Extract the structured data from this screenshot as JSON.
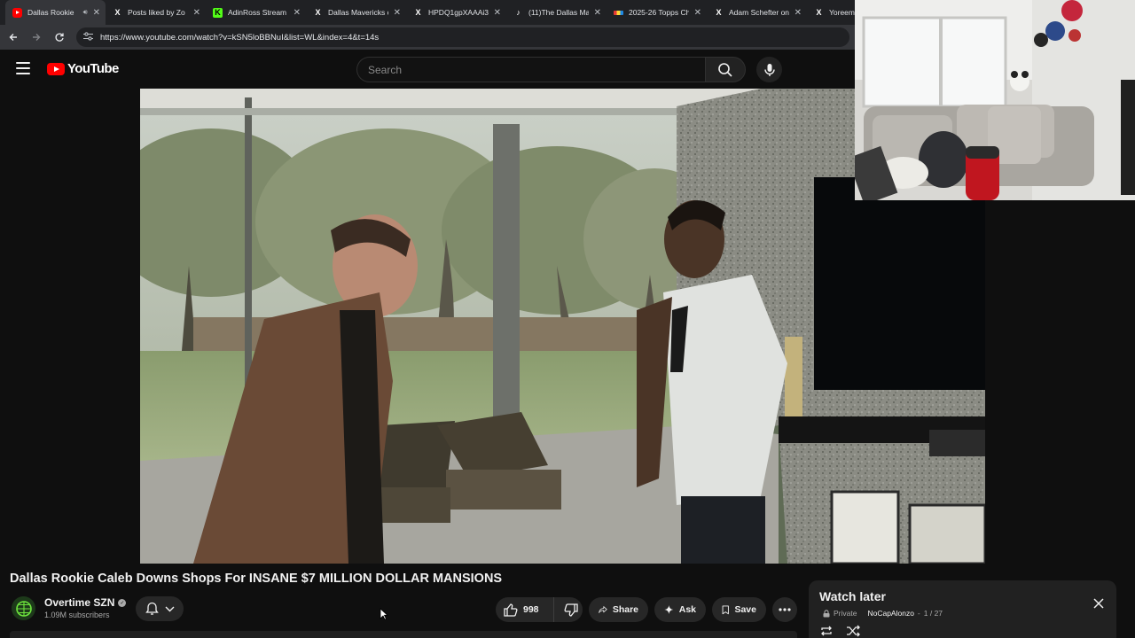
{
  "browser": {
    "tabs": [
      {
        "title": "Dallas Rookie",
        "favicon": "youtube-icon",
        "active": true,
        "audio": true
      },
      {
        "title": "Posts liked by Zo",
        "favicon": "x-icon"
      },
      {
        "title": "AdinRoss Stream",
        "favicon": "kick-icon"
      },
      {
        "title": "Dallas Mavericks o",
        "favicon": "x-icon"
      },
      {
        "title": "HPDQ1gpXAAAi3",
        "favicon": "x-icon"
      },
      {
        "title": "(11)The Dallas Ma",
        "favicon": "tiktok-icon"
      },
      {
        "title": "2025-26 Topps Ch",
        "favicon": "topps-icon"
      },
      {
        "title": "Adam Schefter on",
        "favicon": "x-icon"
      },
      {
        "title": "Yoreem A",
        "favicon": "x-icon"
      }
    ],
    "url": "https://www.youtube.com/watch?v=kSN5loBBNuI&list=WL&index=4&t=14s"
  },
  "header": {
    "logo_text": "YouTube",
    "search_placeholder": "Search"
  },
  "video": {
    "title": "Dallas Rookie Caleb Downs Shops For INSANE $7 MILLION DOLLAR MANSIONS"
  },
  "channel": {
    "name": "Overtime SZN",
    "subscribers": "1.09M subscribers"
  },
  "actions": {
    "like_count": "998",
    "share_label": "Share",
    "ask_label": "Ask",
    "save_label": "Save"
  },
  "playlist": {
    "title": "Watch later",
    "privacy": "Private",
    "owner": "NoCapAlonzo",
    "position": "1 / 27"
  },
  "colors": {
    "brand_red": "#ff0000",
    "background": "#0f0f0f",
    "pill": "#272727"
  }
}
